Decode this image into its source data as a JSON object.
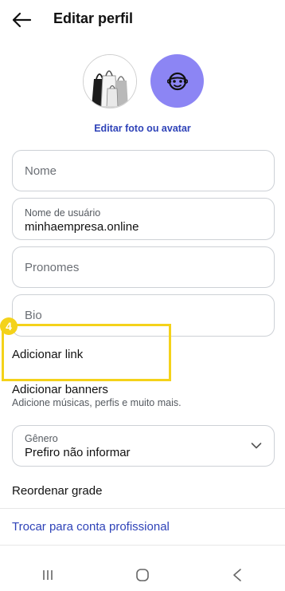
{
  "header": {
    "title": "Editar perfil",
    "back_icon": "arrow-left-icon"
  },
  "profile": {
    "photo_icon": "shopping-bags-photo",
    "avatar_icon": "monkey-face-icon",
    "avatar_color": "#8c85f4",
    "edit_label": "Editar foto ou avatar"
  },
  "form": {
    "name_placeholder": "Nome",
    "username_label": "Nome de usuário",
    "username_value": "minhaempresa.online",
    "pronouns_placeholder": "Pronomes",
    "bio_placeholder": "Bio"
  },
  "highlight": {
    "step": "4",
    "color": "#f4d21a"
  },
  "links": {
    "add_link": "Adicionar link",
    "add_banners": "Adicionar banners",
    "add_banners_sub": "Adicione músicas, perfis e muito mais."
  },
  "gender": {
    "label": "Gênero",
    "value": "Prefiro não informar"
  },
  "reorder_grid": "Reordenar grade",
  "switch_pro": "Trocar para conta profissional",
  "accent_color": "#2f43b8",
  "navbar": {
    "recent_icon": "recent-apps-icon",
    "home_icon": "home-circle-icon",
    "back_icon": "nav-back-icon"
  }
}
